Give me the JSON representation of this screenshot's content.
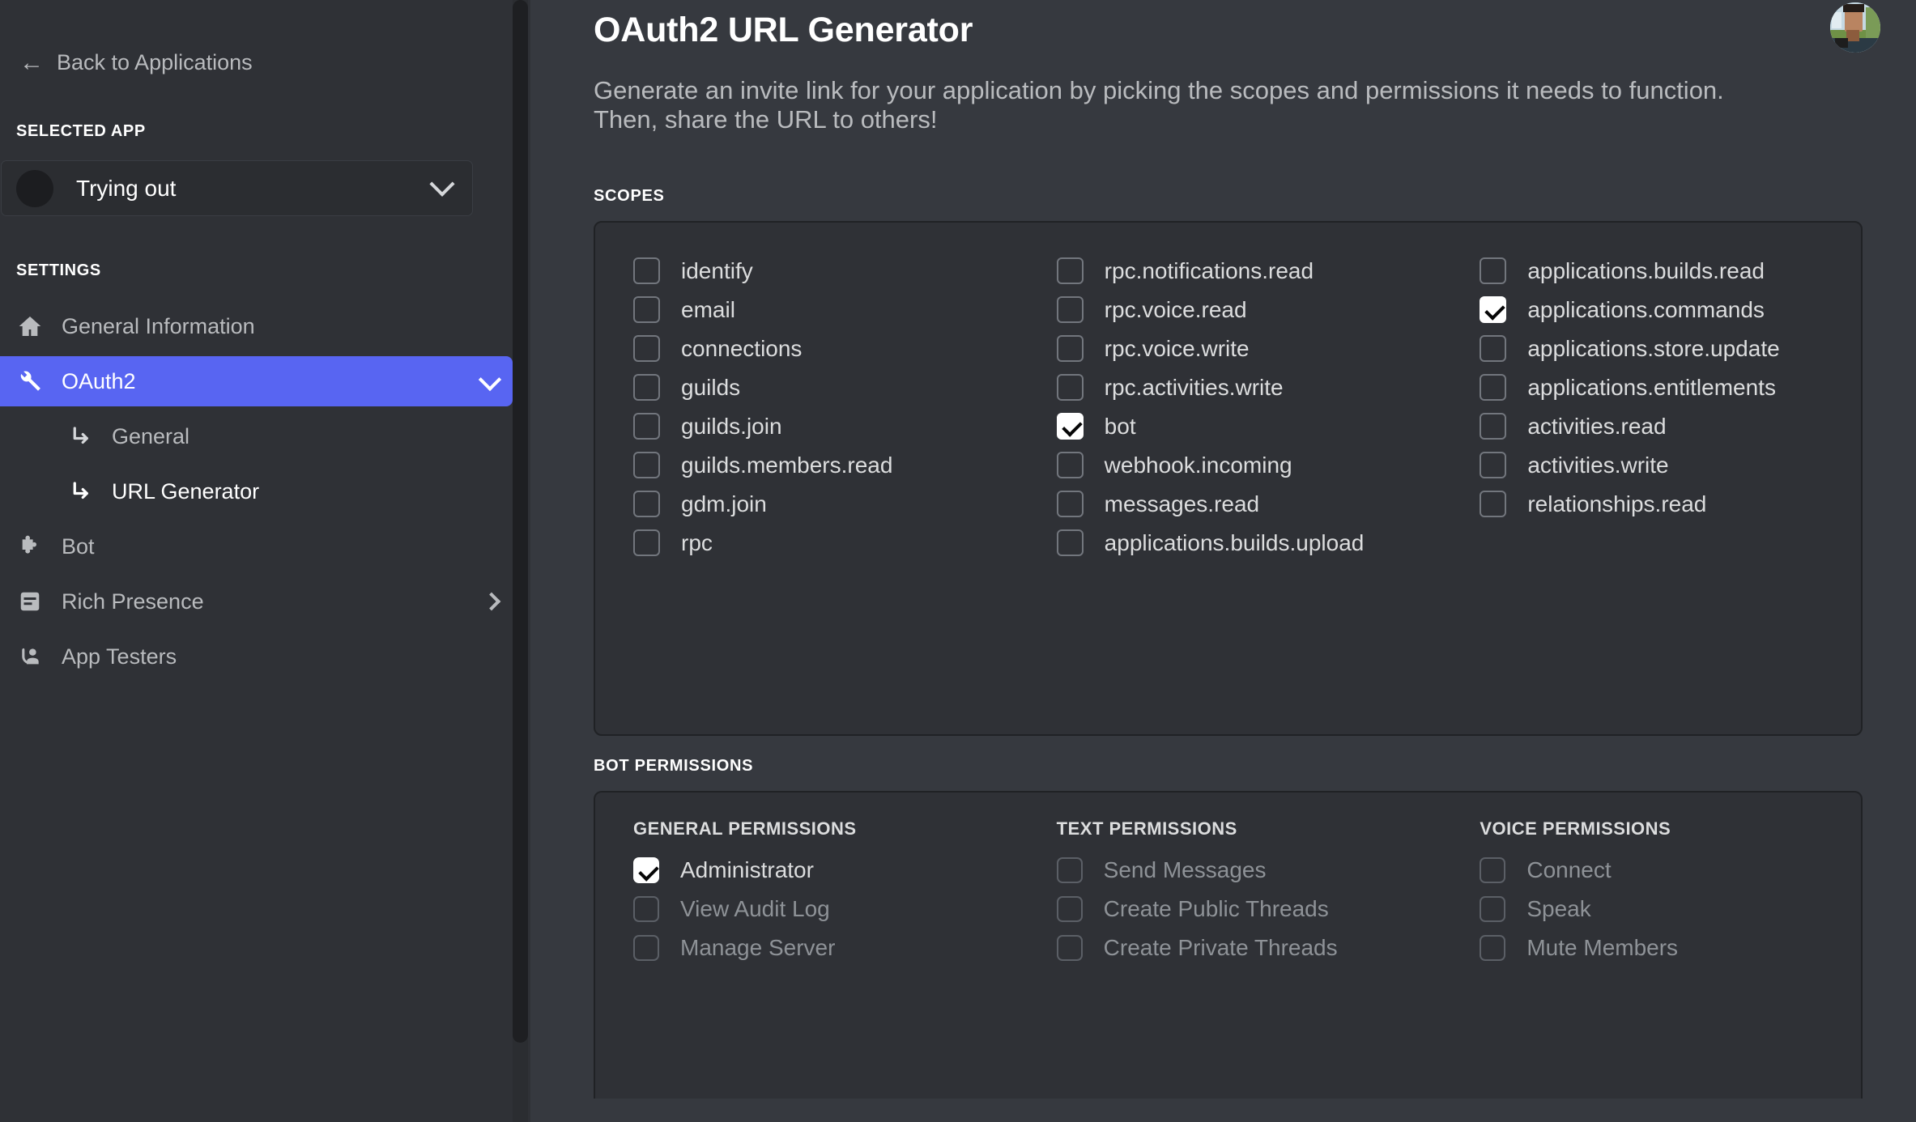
{
  "sidebar": {
    "back_label": "Back to Applications",
    "back_icon": "arrow-left-icon",
    "selected_app_header": "SELECTED APP",
    "selected_app_name": "Trying out",
    "settings_header": "SETTINGS",
    "items": [
      {
        "label": "General Information",
        "icon": "home-icon",
        "active": false,
        "chevron": "none"
      },
      {
        "label": "OAuth2",
        "icon": "wrench-icon",
        "active": true,
        "chevron": "down"
      },
      {
        "label": "Bot",
        "icon": "puzzle-icon",
        "active": false,
        "chevron": "none"
      },
      {
        "label": "Rich Presence",
        "icon": "document-icon",
        "active": false,
        "chevron": "right"
      },
      {
        "label": "App Testers",
        "icon": "person-raised-hand-icon",
        "active": false,
        "chevron": "none"
      }
    ],
    "sub_items": [
      {
        "label": "General",
        "icon": "corner-arrow-icon",
        "current": false
      },
      {
        "label": "URL Generator",
        "icon": "corner-arrow-icon",
        "current": true
      }
    ]
  },
  "main": {
    "title": "OAuth2 URL Generator",
    "description": "Generate an invite link for your application by picking the scopes and permissions it needs to function. Then, share the URL to others!",
    "avatar_name": "user-avatar",
    "scopes_header": "SCOPES",
    "bot_permissions_header": "BOT PERMISSIONS",
    "scopes_columns": [
      [
        {
          "label": "identify",
          "checked": false
        },
        {
          "label": "email",
          "checked": false
        },
        {
          "label": "connections",
          "checked": false
        },
        {
          "label": "guilds",
          "checked": false
        },
        {
          "label": "guilds.join",
          "checked": false
        },
        {
          "label": "guilds.members.read",
          "checked": false
        },
        {
          "label": "gdm.join",
          "checked": false
        },
        {
          "label": "rpc",
          "checked": false
        }
      ],
      [
        {
          "label": "rpc.notifications.read",
          "checked": false
        },
        {
          "label": "rpc.voice.read",
          "checked": false
        },
        {
          "label": "rpc.voice.write",
          "checked": false
        },
        {
          "label": "rpc.activities.write",
          "checked": false
        },
        {
          "label": "bot",
          "checked": true
        },
        {
          "label": "webhook.incoming",
          "checked": false
        },
        {
          "label": "messages.read",
          "checked": false
        },
        {
          "label": "applications.builds.upload",
          "checked": false
        }
      ],
      [
        {
          "label": "applications.builds.read",
          "checked": false
        },
        {
          "label": "applications.commands",
          "checked": true
        },
        {
          "label": "applications.store.update",
          "checked": false
        },
        {
          "label": "applications.entitlements",
          "checked": false
        },
        {
          "label": "activities.read",
          "checked": false
        },
        {
          "label": "activities.write",
          "checked": false
        },
        {
          "label": "relationships.read",
          "checked": false
        }
      ]
    ],
    "permission_columns": [
      {
        "header": "GENERAL PERMISSIONS",
        "items": [
          {
            "label": "Administrator",
            "checked": true
          },
          {
            "label": "View Audit Log",
            "checked": false
          },
          {
            "label": "Manage Server",
            "checked": false
          }
        ]
      },
      {
        "header": "TEXT PERMISSIONS",
        "items": [
          {
            "label": "Send Messages",
            "checked": false
          },
          {
            "label": "Create Public Threads",
            "checked": false
          },
          {
            "label": "Create Private Threads",
            "checked": false
          }
        ]
      },
      {
        "header": "VOICE PERMISSIONS",
        "items": [
          {
            "label": "Connect",
            "checked": false
          },
          {
            "label": "Speak",
            "checked": false
          },
          {
            "label": "Mute Members",
            "checked": false
          }
        ]
      }
    ]
  },
  "colors": {
    "accent": "#5865f2",
    "sidebar_bg": "#2f3136",
    "main_bg": "#36393f",
    "panel_border": "#202225",
    "text_primary": "#ffffff",
    "text_muted": "#b9bbbe",
    "text_disabled": "#8e9297"
  }
}
